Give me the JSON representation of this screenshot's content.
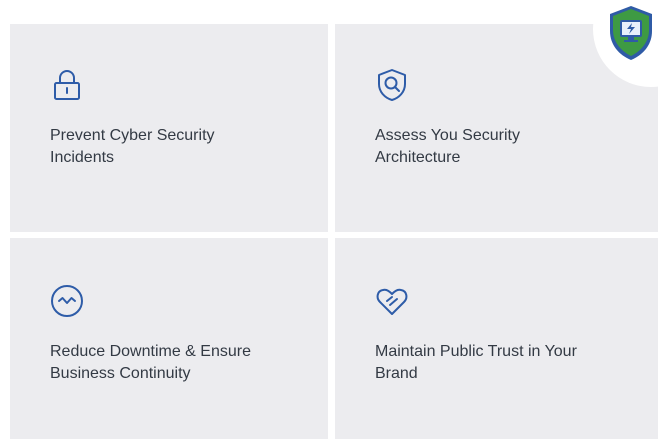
{
  "cards": [
    {
      "label": "Prevent Cyber Security Incidents",
      "icon": "lock-icon"
    },
    {
      "label": "Assess You Security Architecture",
      "icon": "shield-search-icon"
    },
    {
      "label": "Reduce Downtime & Ensure Business Continuity",
      "icon": "pulse-circle-icon"
    },
    {
      "label": "Maintain Public Trust in Your Brand",
      "icon": "heart-check-icon"
    }
  ],
  "badge": {
    "icon": "shield-computer-badge-icon"
  },
  "colors": {
    "card_bg": "#ececef",
    "icon_blue": "#2e5ca8",
    "text": "#333a44",
    "shield_green": "#3e9a43",
    "shield_blue": "#2f5ba6"
  }
}
